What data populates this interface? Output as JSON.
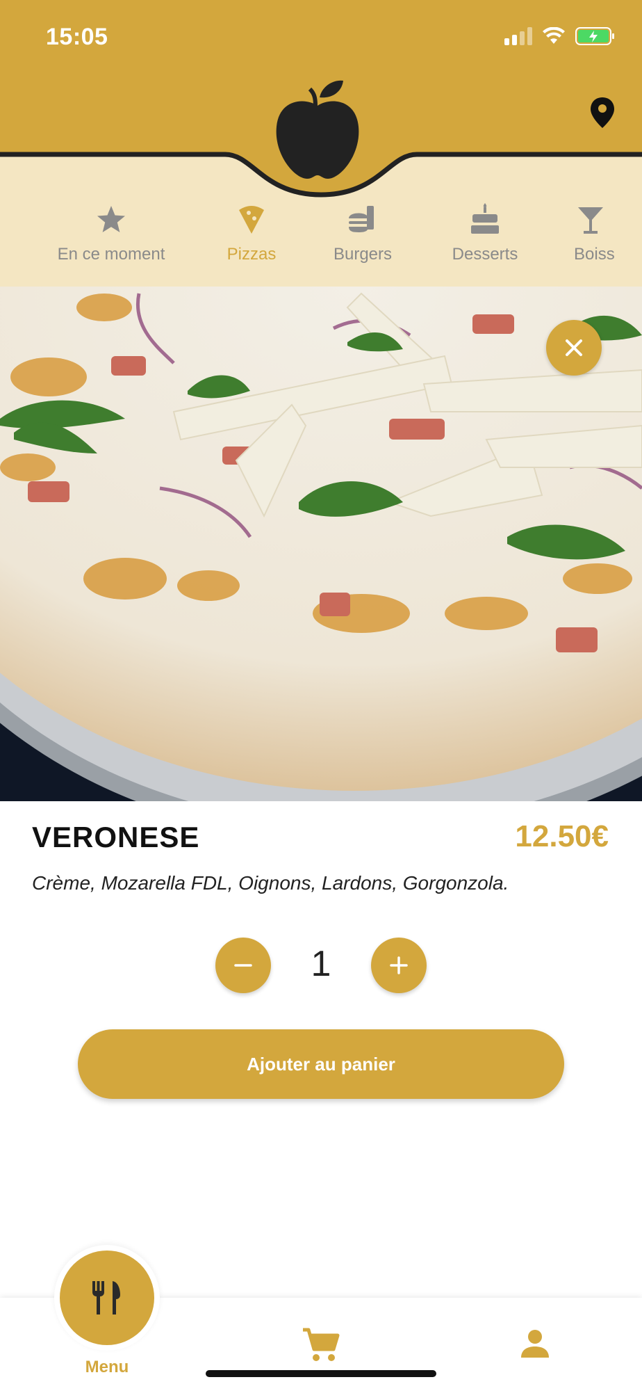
{
  "status_bar": {
    "time": "15:05"
  },
  "header": {
    "logo_icon": "apple-logo-icon",
    "location_icon": "map-pin-icon"
  },
  "categories": [
    {
      "label": "En ce moment",
      "icon": "star-icon",
      "active": false
    },
    {
      "label": "Pizzas",
      "icon": "pizza-slice-icon",
      "active": true
    },
    {
      "label": "Burgers",
      "icon": "burger-icon",
      "active": false
    },
    {
      "label": "Desserts",
      "icon": "cake-icon",
      "active": false
    },
    {
      "label": "Boiss",
      "icon": "cocktail-icon",
      "active": false
    }
  ],
  "product": {
    "name": "VERONESE",
    "price": "12.50€",
    "description": "Crème, Mozarella FDL, Oignons, Lardons, Gorgonzola.",
    "quantity": "1",
    "add_to_cart_label": "Ajouter au panier"
  },
  "bottom_nav": {
    "menu_label": "Menu",
    "cart_icon": "cart-icon",
    "profile_icon": "user-icon"
  },
  "colors": {
    "accent": "#d3a73d",
    "header_band": "#f4e6c2",
    "inactive": "#8a8a8a"
  }
}
